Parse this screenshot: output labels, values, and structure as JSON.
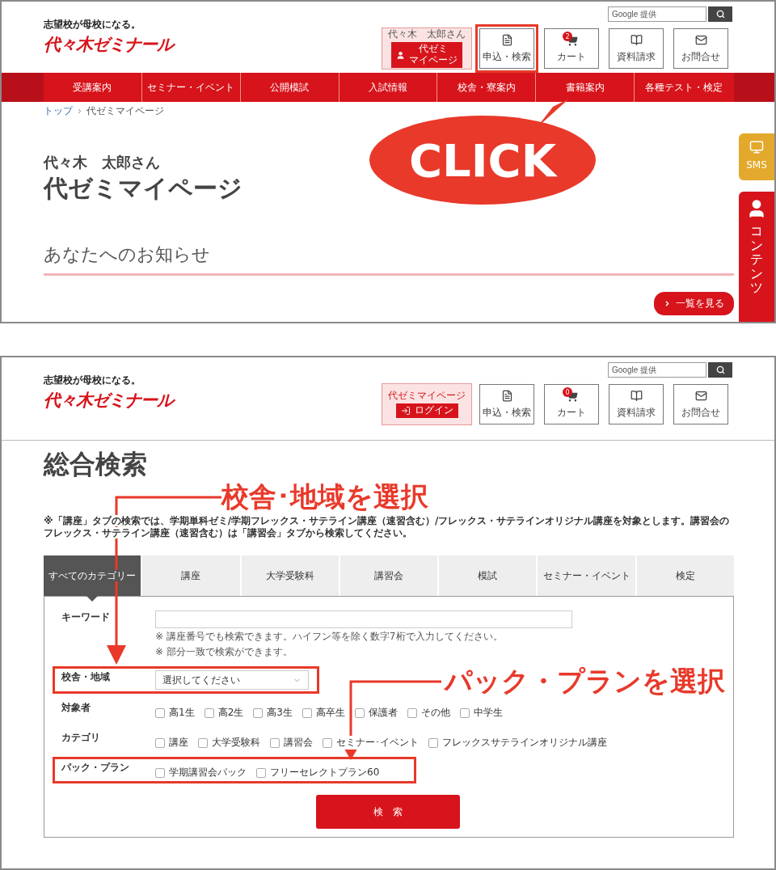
{
  "step1": {
    "header": {
      "tagline": "志望校が母校になる。",
      "logo": "代々木ゼミナール",
      "search": {
        "placeholder": "Google 提供"
      },
      "user": {
        "name": "代々木　太郎さん",
        "button": [
          "代ゼミ",
          "マイページ"
        ]
      },
      "icons": [
        {
          "kind": "document",
          "label": "申込・検索",
          "highlighted": true
        },
        {
          "kind": "cart",
          "label": "カート",
          "badge": "2",
          "highlighted": false
        },
        {
          "kind": "book",
          "label": "資料請求",
          "highlighted": false
        },
        {
          "kind": "mail",
          "label": "お問合せ",
          "highlighted": false
        }
      ]
    },
    "nav": [
      "受講案内",
      "セミナー・イベント",
      "公開模試",
      "入試情報",
      "校舎・寮案内",
      "書籍案内",
      "各種テスト・検定"
    ],
    "breadcrumb": [
      "トップ",
      "代ゼミマイページ"
    ],
    "greeting": "代々木　太郎さん",
    "title": "代ゼミマイページ",
    "section": "あなたへのお知らせ",
    "more_button": "一覧を見る",
    "side_tabs": [
      {
        "kind": "monitor",
        "label": "SMS",
        "color": "#e3a92c"
      },
      {
        "kind": "person",
        "label": "コンテンツ",
        "color": "#d7141b"
      }
    ],
    "callout": "CLICK"
  },
  "step2": {
    "header": {
      "tagline": "志望校が母校になる。",
      "logo": "代々木ゼミナール",
      "search": {
        "placeholder": "Google 提供"
      },
      "user": {
        "name": "代ゼミマイページ",
        "button": [
          "ログイン"
        ]
      },
      "icons": [
        {
          "kind": "document",
          "label": "申込・検索",
          "highlighted": false
        },
        {
          "kind": "cart",
          "label": "カート",
          "badge": "0",
          "highlighted": false
        },
        {
          "kind": "book",
          "label": "資料請求",
          "highlighted": false
        },
        {
          "kind": "mail",
          "label": "お問合せ",
          "highlighted": false
        }
      ]
    },
    "title": "総合検索",
    "notice": "※「講座」タブの検索では、学期単科ゼミ/学期フレックス・サテライン講座（速習含む）/フレックス・サテラインオリジナル講座を対象とします。講習会のフレックス・サテライン講座（速習含む）は「講習会」タブから検索してください。",
    "tabs": [
      {
        "label": "すべてのカテゴリー",
        "selected": true
      },
      {
        "label": "講座",
        "selected": false
      },
      {
        "label": "大学受験科",
        "selected": false
      },
      {
        "label": "講習会",
        "selected": false
      },
      {
        "label": "模試",
        "selected": false
      },
      {
        "label": "セミナー・イベント",
        "selected": false
      },
      {
        "label": "検定",
        "selected": false
      }
    ],
    "form": [
      {
        "kind": "text",
        "label": "キーワード",
        "hints": [
          "※ 講座番号でも検索できます。ハイフン等を除く数字7桁で入力してください。",
          "※ 部分一致で検索ができます。"
        ],
        "highlighted": false
      },
      {
        "kind": "select",
        "label": "校舎・地域",
        "placeholder": "選択してください",
        "highlighted": true
      },
      {
        "kind": "checks",
        "label": "対象者",
        "options": [
          {
            "label": "高1生",
            "checked": false
          },
          {
            "label": "高2生",
            "checked": false
          },
          {
            "label": "高3生",
            "checked": false
          },
          {
            "label": "高卒生",
            "checked": false
          },
          {
            "label": "保護者",
            "checked": false
          },
          {
            "label": "その他",
            "checked": false
          },
          {
            "label": "中学生",
            "checked": false
          }
        ],
        "highlighted": false
      },
      {
        "kind": "checks",
        "label": "カテゴリ",
        "options": [
          {
            "label": "講座",
            "checked": false
          },
          {
            "label": "大学受験科",
            "checked": false
          },
          {
            "label": "講習会",
            "checked": false
          },
          {
            "label": "セミナー･イベント",
            "checked": false
          },
          {
            "label": "フレックスサテラインオリジナル講座",
            "checked": false
          }
        ],
        "highlighted": false
      },
      {
        "kind": "checks",
        "label": "パック・プラン",
        "options": [
          {
            "label": "学期講習会パック",
            "checked": false
          },
          {
            "label": "フリーセレクトプラン60",
            "checked": false
          }
        ],
        "highlighted": true
      }
    ],
    "search_button": "検　索",
    "annotations": [
      "校舎･地域を選択",
      "パック・プランを選択"
    ]
  }
}
